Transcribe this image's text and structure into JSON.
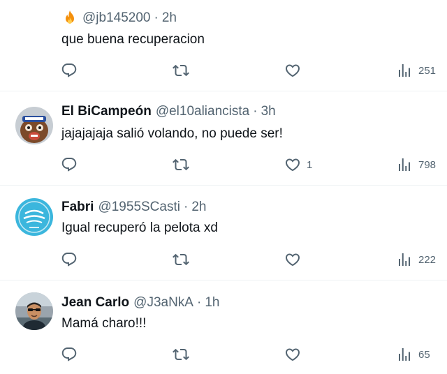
{
  "tweets": [
    {
      "name": "",
      "handle": "@jb145200",
      "time": "2h",
      "text": "que buena recuperacion",
      "reply_count": "",
      "retweet_count": "",
      "like_count": "",
      "view_count": "251"
    },
    {
      "name": "El BiCampeón",
      "handle": "@el10aliancista",
      "time": "3h",
      "text": "jajajajaja salió volando, no puede ser!",
      "reply_count": "",
      "retweet_count": "",
      "like_count": "1",
      "view_count": "798"
    },
    {
      "name": "Fabri",
      "handle": "@1955SCasti",
      "time": "2h",
      "text": "Igual recuperó la pelota xd",
      "reply_count": "",
      "retweet_count": "",
      "like_count": "",
      "view_count": "222"
    },
    {
      "name": "Jean Carlo",
      "handle": "@J3aNkA",
      "time": "1h",
      "text": "Mamá charo!!!",
      "reply_count": "",
      "retweet_count": "",
      "like_count": "",
      "view_count": "65"
    }
  ],
  "separator": "·",
  "colors": {
    "text": "#0f1419",
    "muted": "#536471",
    "divider": "#eff3f4"
  },
  "icons": [
    "fire-emoji-icon",
    "reply-icon",
    "retweet-icon",
    "like-icon",
    "views-icon"
  ]
}
